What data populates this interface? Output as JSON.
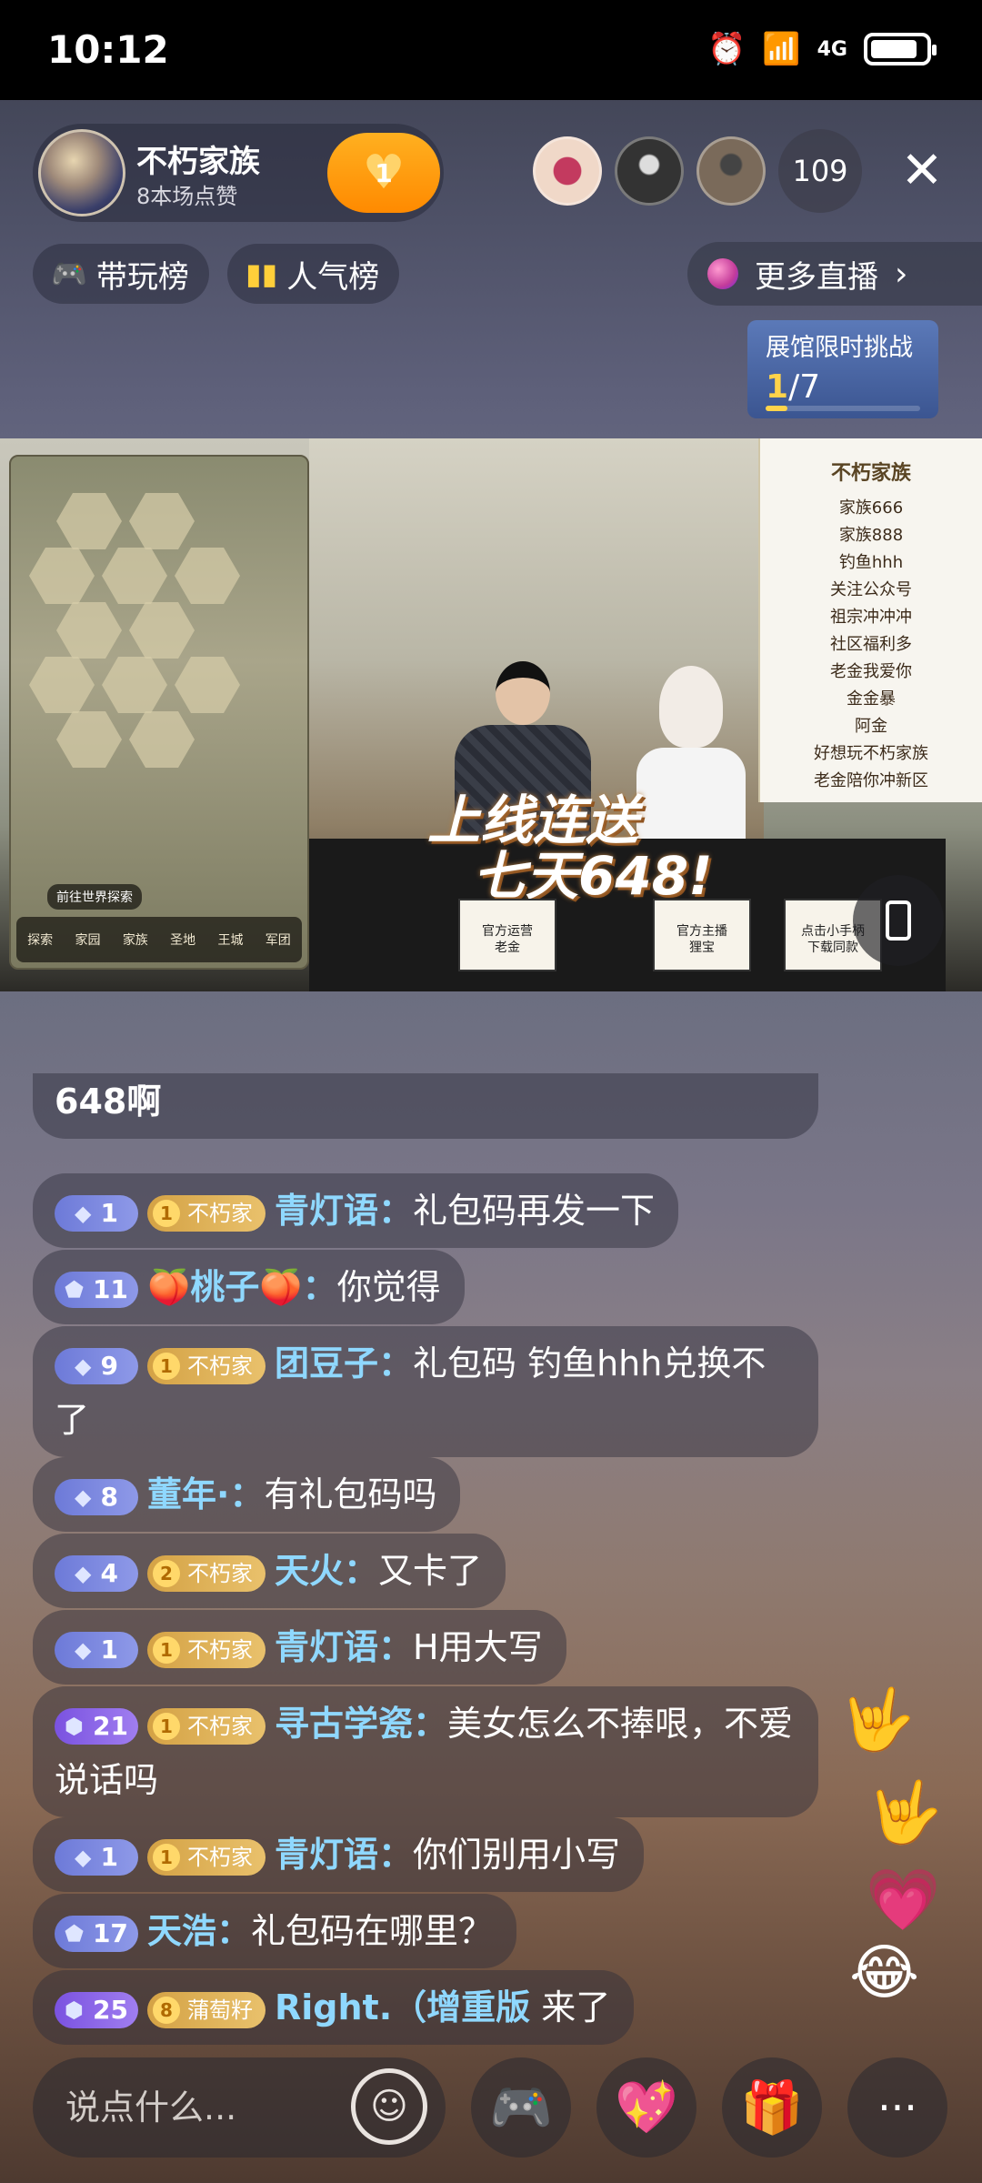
{
  "status": {
    "time": "10:12",
    "network": "4G"
  },
  "host": {
    "name": "不朽家族",
    "likes": "8本场点赞",
    "follow_count": "1"
  },
  "viewers": {
    "count": "109"
  },
  "chips": {
    "play_rank": "带玩榜",
    "popular_rank": "人气榜",
    "more_live": "更多直播"
  },
  "challenge": {
    "title": "展馆限时挑战",
    "current": "1",
    "total": "/7",
    "progress": 0.1428
  },
  "video": {
    "promo_line1": "上线连送",
    "promo_line2": "七天648!",
    "signs": [
      "官方运营\n老金",
      "官方主播\n狸宝",
      "点击小手柄\n下载同款"
    ],
    "banner_logo": "不朽家族",
    "banner_lines": [
      "家族666",
      "家族888",
      "钓鱼hhh",
      "关注公众号",
      "祖宗冲冲冲",
      "社区福利多",
      "老金我爱你",
      "金金暴",
      "阿金",
      "好想玩不朽家族",
      "老金陪你冲新区"
    ],
    "game_tabs": [
      "探索",
      "家园",
      "家族",
      "圣地",
      "王城",
      "军团"
    ],
    "game_button": "前往世界探索"
  },
  "chat": [
    {
      "level": "",
      "fan": "",
      "nick": "",
      "text": "648啊"
    },
    {
      "level": "1",
      "fan_level": "1",
      "fan": "不朽家",
      "nick": "青灯语：",
      "text": "礼包码再发一下"
    },
    {
      "level": "11",
      "nick": "🍑桃子🍑：",
      "text": "你觉得"
    },
    {
      "level": "9",
      "fan_level": "1",
      "fan": "不朽家",
      "nick": "团豆子：",
      "text": "礼包码  钓鱼hhh兑换不了"
    },
    {
      "level": "8",
      "nick": "董年·：",
      "text": "有礼包码吗"
    },
    {
      "level": "4",
      "fan_level": "2",
      "fan": "不朽家",
      "nick": "天火：",
      "text": "又卡了"
    },
    {
      "level": "1",
      "fan_level": "1",
      "fan": "不朽家",
      "nick": "青灯语：",
      "text": "H用大写"
    },
    {
      "level": "21",
      "fan_level": "1",
      "fan": "不朽家",
      "nick": "寻古学瓷：",
      "text": "美女怎么不捧哏，不爱说话吗"
    },
    {
      "level": "1",
      "fan_level": "1",
      "fan": "不朽家",
      "nick": "青灯语：",
      "text": "你们别用小写"
    },
    {
      "level": "17",
      "nick": "天浩：",
      "text": "礼包码在哪里？"
    },
    {
      "level": "25",
      "fan_level": "8",
      "fan": "蒲萄籽",
      "nick": "Right.（增重版",
      "text": " 来了"
    }
  ],
  "bottom": {
    "input_placeholder": "说点什么..."
  },
  "colors": {
    "accent": "#ff8a00",
    "nick": "#8fd8ff",
    "level_badge": "#7f8ce6",
    "fan_badge": "#d9a94e"
  }
}
